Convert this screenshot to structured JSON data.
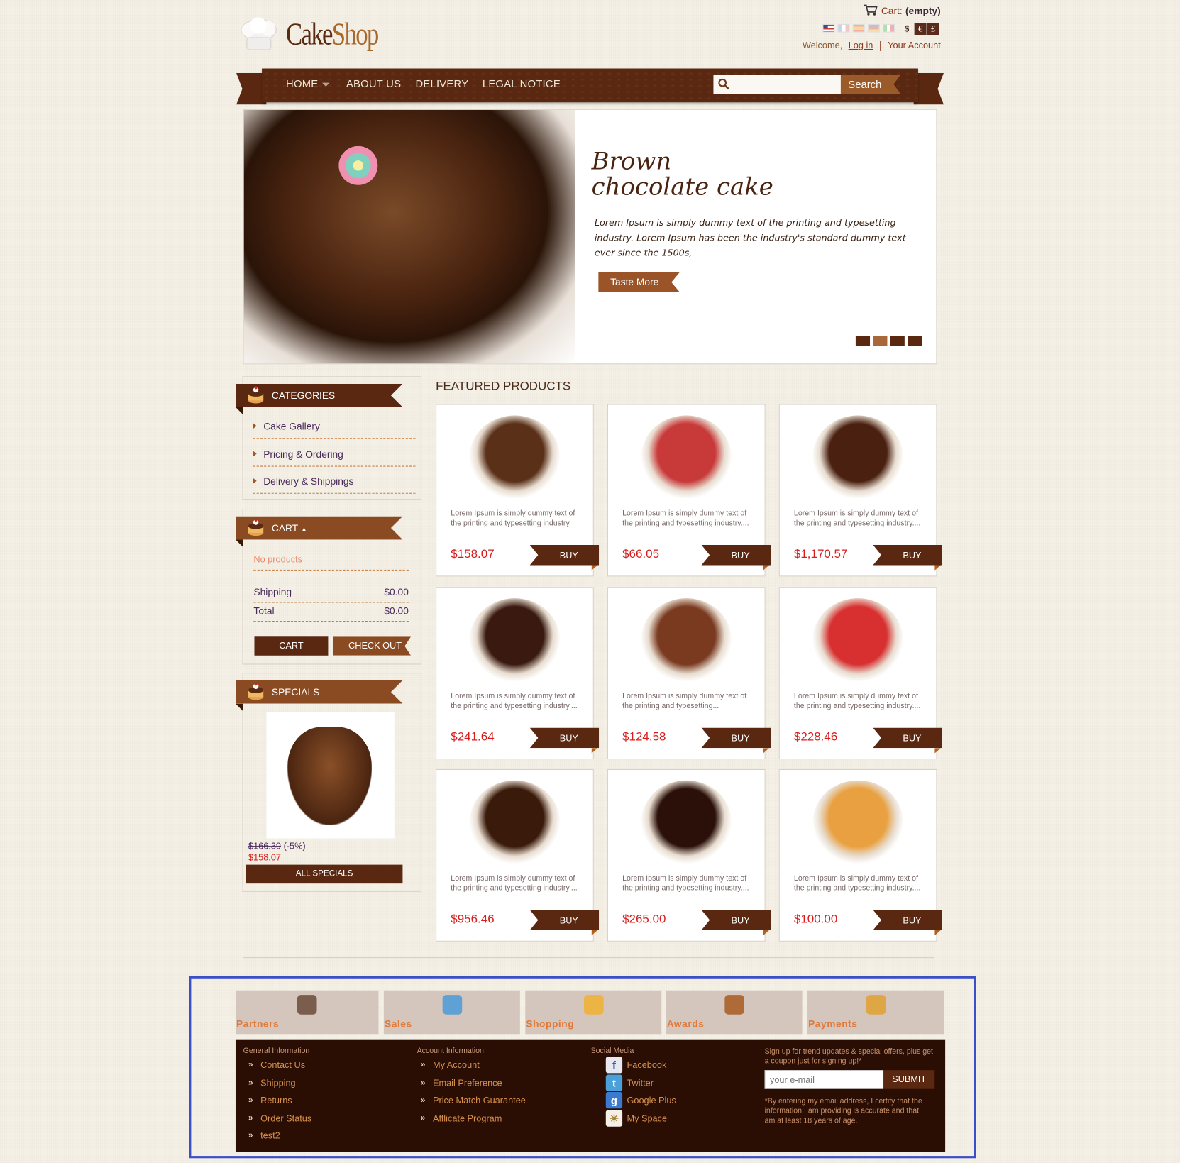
{
  "header": {
    "logo_part1": "Cake",
    "logo_part2": "Shop",
    "cart_label": "Cart:",
    "cart_status": "(empty)",
    "languages": [
      "English",
      "French",
      "Spanish",
      "German",
      "Italian"
    ],
    "currencies": [
      "$",
      "€",
      "£"
    ],
    "welcome_text": "Welcome,",
    "login_link": "Log in",
    "account_link": "Your Account"
  },
  "nav": {
    "items": [
      "HOME",
      "ABOUT US",
      "DELIVERY",
      "LEGAL NOTICE"
    ],
    "search_placeholder": "",
    "search_button": "Search"
  },
  "hero": {
    "title_line1": "Brown",
    "title_line2": "chocolate cake",
    "text": "Lorem Ipsum is simply dummy text of the printing and typesetting industry. Lorem Ipsum has been the industry's standard dummy text ever since the 1500s,",
    "button": "Taste More",
    "slides": 4,
    "active_slide": 1
  },
  "sidebar": {
    "categories": {
      "title": "CATEGORIES",
      "items": [
        "Cake Gallery",
        "Pricing & Ordering",
        "Delivery & Shippings"
      ]
    },
    "cart": {
      "title": "CART",
      "empty_text": "No products",
      "shipping_label": "Shipping",
      "shipping_value": "$0.00",
      "total_label": "Total",
      "total_value": "$0.00",
      "cart_button": "CART",
      "checkout_button": "CHECK OUT"
    },
    "specials": {
      "title": "SPECIALS",
      "old_price": "$166.39",
      "discount": "(-5%)",
      "new_price": "$158.07",
      "button": "ALL SPECIALS"
    }
  },
  "featured": {
    "title": "FEATURED PRODUCTS",
    "buy_label": "BUY",
    "products": [
      {
        "desc": "Lorem Ipsum is simply dummy text of the printing and typesetting industry.",
        "price": "$158.07",
        "color": "#5a3018"
      },
      {
        "desc": "Lorem Ipsum is simply dummy text of the printing and typesetting industry....",
        "price": "$66.05",
        "color": "#c83a3a"
      },
      {
        "desc": "Lorem Ipsum is simply dummy text of the printing and typesetting industry....",
        "price": "$1,170.57",
        "color": "#4a2010"
      },
      {
        "desc": "Lorem Ipsum is simply dummy text of the printing and typesetting industry....",
        "price": "$241.64",
        "color": "#3a1a10"
      },
      {
        "desc": "Lorem Ipsum is simply dummy text of the printing and typesetting...",
        "price": "$124.58",
        "color": "#7a3a20"
      },
      {
        "desc": "Lorem Ipsum is simply dummy text of the printing and typesetting industry....",
        "price": "$228.46",
        "color": "#d83030"
      },
      {
        "desc": "Lorem Ipsum is simply dummy text of the printing and typesetting industry....",
        "price": "$956.46",
        "color": "#3a1a0a"
      },
      {
        "desc": "Lorem Ipsum is simply dummy text of the printing and typesetting industry....",
        "price": "$265.00",
        "color": "#2a1008"
      },
      {
        "desc": "Lorem Ipsum is simply dummy text of the printing and typesetting industry....",
        "price": "$100.00",
        "color": "#e8a040"
      }
    ]
  },
  "footer": {
    "tiles": [
      {
        "label": "Partners",
        "icon": "partners-icon"
      },
      {
        "label": "Sales",
        "icon": "sales-icon"
      },
      {
        "label": "Shopping",
        "icon": "shopping-bag-icon"
      },
      {
        "label": "Awards",
        "icon": "trophy-icon"
      },
      {
        "label": "Payments",
        "icon": "coins-icon"
      }
    ],
    "general": {
      "title": "General Information",
      "links": [
        "Contact Us",
        "Shipping",
        "Returns",
        "Order Status",
        "test2"
      ]
    },
    "account": {
      "title": "Account Information",
      "links": [
        "My Account",
        "Email Preference",
        "Price Match Guarantee",
        "Afflicate Program"
      ]
    },
    "social": {
      "title": "Social Media",
      "links": [
        "Facebook",
        "Twitter",
        "Google Plus",
        "My Space"
      ]
    },
    "newsletter": {
      "intro": "Sign up for trend updates & special offers, plus get a coupon just for signing up!*",
      "placeholder": "your e-mail",
      "button": "SUBMIT",
      "disclaimer": "*By entering my email address, I certify that the information I am providing is accurate and that I am at least 18 years of age."
    }
  }
}
